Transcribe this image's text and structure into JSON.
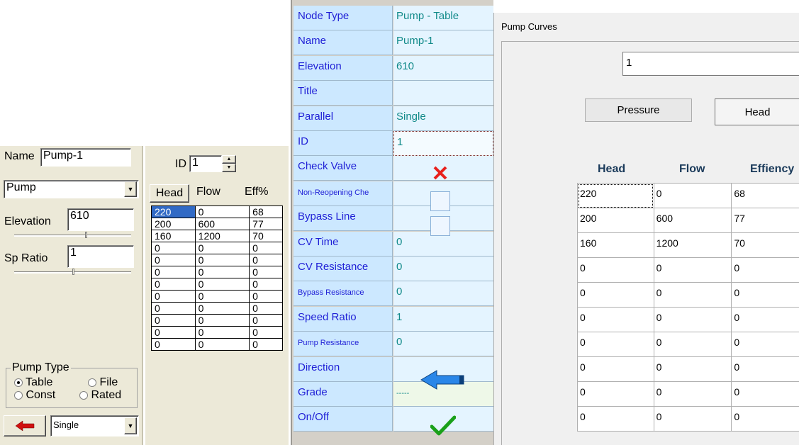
{
  "left_panel": {
    "name_label": "Name",
    "name_value": "Pump-1",
    "element_type": "Pump",
    "elevation_label": "Elevation",
    "elevation_value": "610",
    "sp_ratio_label": "Sp Ratio",
    "sp_ratio_value": "1",
    "pump_type_legend": "Pump Type",
    "pump_type_options": [
      "Table",
      "File",
      "Const",
      "Rated"
    ],
    "pump_type_selected": "Table",
    "parallel_value": "Single"
  },
  "mid_panel": {
    "id_label": "ID",
    "id_value": "1",
    "headers": [
      "Head",
      "Flow",
      "Eff%"
    ],
    "rows": [
      [
        "220",
        "0",
        "68"
      ],
      [
        "200",
        "600",
        "77"
      ],
      [
        "160",
        "1200",
        "70"
      ],
      [
        "0",
        "0",
        "0"
      ],
      [
        "0",
        "0",
        "0"
      ],
      [
        "0",
        "0",
        "0"
      ],
      [
        "0",
        "0",
        "0"
      ],
      [
        "0",
        "0",
        "0"
      ],
      [
        "0",
        "0",
        "0"
      ],
      [
        "0",
        "0",
        "0"
      ],
      [
        "0",
        "0",
        "0"
      ],
      [
        "0",
        "0",
        "0"
      ]
    ]
  },
  "properties": [
    {
      "name": "Node Type",
      "value": "Pump - Table"
    },
    {
      "name": "Name",
      "value": "Pump-1"
    },
    {
      "name": "Elevation",
      "value": "610"
    },
    {
      "name": "Title",
      "value": ""
    },
    {
      "name": "Parallel",
      "value": "Single"
    },
    {
      "name": "ID",
      "value": "1"
    },
    {
      "name": "Check Valve",
      "value": ""
    },
    {
      "name": "Non-Reopening Che",
      "value": ""
    },
    {
      "name": "Bypass Line",
      "value": ""
    },
    {
      "name": "CV Time",
      "value": "0"
    },
    {
      "name": "CV Resistance",
      "value": "0"
    },
    {
      "name": "Bypass Resistance",
      "value": "0"
    },
    {
      "name": "Speed Ratio",
      "value": "1"
    },
    {
      "name": "Pump Resistance",
      "value": "0"
    },
    {
      "name": "Direction",
      "value": ""
    },
    {
      "name": "Grade",
      "value": "-----"
    },
    {
      "name": "On/Off",
      "value": ""
    }
  ],
  "curves_window": {
    "title": "Pump Curves",
    "curve_id": "1",
    "pressure_button": "Pressure",
    "head_button": "Head",
    "headers": [
      "Head",
      "Flow",
      "Effiency"
    ],
    "rows": [
      [
        "220",
        "0",
        "68"
      ],
      [
        "200",
        "600",
        "77"
      ],
      [
        "160",
        "1200",
        "70"
      ],
      [
        "0",
        "0",
        "0"
      ],
      [
        "0",
        "0",
        "0"
      ],
      [
        "0",
        "0",
        "0"
      ],
      [
        "0",
        "0",
        "0"
      ],
      [
        "0",
        "0",
        "0"
      ],
      [
        "0",
        "0",
        "0"
      ],
      [
        "0",
        "0",
        "0"
      ]
    ]
  },
  "colors": {
    "property_name_bg": "#cce8ff",
    "property_name_text": "#1f1fd6",
    "property_value_text": "#128a8a",
    "check_valve_x": "#e8201c",
    "direction_arrow": "#2a86e8",
    "onoff_check": "#1aa01a"
  }
}
